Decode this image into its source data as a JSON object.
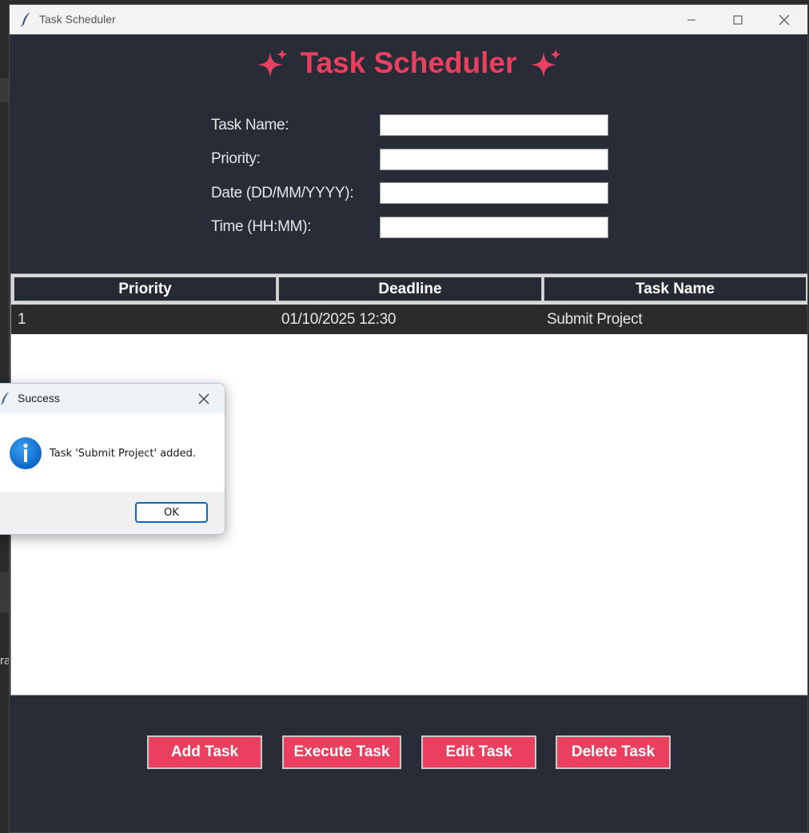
{
  "window": {
    "title": "Task Scheduler"
  },
  "app": {
    "heading": "Task Scheduler",
    "accent_color": "#e8405e",
    "background_color": "#282c37"
  },
  "form": {
    "task_name_label": "Task Name:",
    "priority_label": "Priority:",
    "date_label": "Date (DD/MM/YYYY):",
    "time_label": "Time (HH:MM):",
    "task_name_value": "",
    "priority_value": "",
    "date_value": "",
    "time_value": ""
  },
  "table": {
    "columns": [
      "Priority",
      "Deadline",
      "Task Name"
    ],
    "rows": [
      {
        "priority": "1",
        "deadline": "01/10/2025 12:30",
        "task_name": "Submit Project"
      }
    ]
  },
  "actions": {
    "add": "Add Task",
    "execute": "Execute Task",
    "edit": "Edit Task",
    "delete": "Delete Task"
  },
  "dialog": {
    "title": "Success",
    "message": "Task 'Submit Project' added.",
    "ok": "OK",
    "icon": "info-icon"
  },
  "background": {
    "partial_text": "ra"
  }
}
